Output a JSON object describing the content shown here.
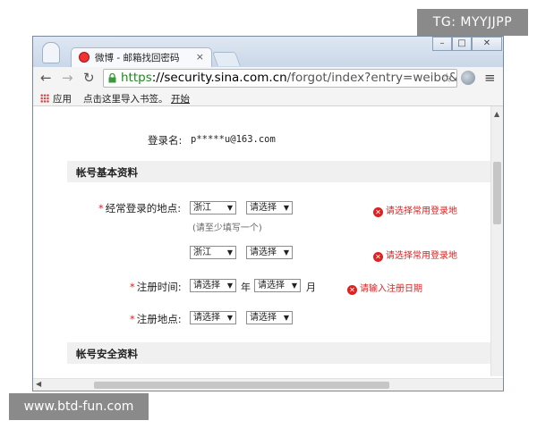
{
  "watermarks": {
    "top_right": "TG: MYYJJPP",
    "bottom_left": "www.btd-fun.com"
  },
  "browser": {
    "tab_title": "微博 - 邮箱找回密码",
    "tab_close": "×",
    "window_buttons": {
      "minimize": "–",
      "maximize": "□",
      "close": "✕"
    },
    "url": {
      "scheme": "https",
      "host": "://security.sina.com.cn",
      "path": "/forgot/index?entry=weibo&type"
    },
    "bookmarks": {
      "apps": "应用",
      "import_hint": "点击这里导入书签。",
      "start": "开始"
    }
  },
  "form": {
    "login_label": "登录名:",
    "login_value": "p*****u@163.com",
    "section_basic": "帐号基本资料",
    "section_security": "帐号安全资料",
    "required_mark": "*",
    "frequent_location_label": "经常登录的地点:",
    "frequent_location_hint": "(请至少填写一个)",
    "row1": {
      "province": "浙江",
      "city": "请选择"
    },
    "row2": {
      "province": "浙江",
      "city": "请选择"
    },
    "reg_time_label": "注册时间:",
    "reg_time": {
      "year": "请选择",
      "year_unit": "年",
      "month": "请选择",
      "month_unit": "月"
    },
    "reg_place_label": "注册地点:",
    "reg_place": {
      "province": "请选择",
      "city": "请选择"
    },
    "errors": {
      "location1": "请选择常用登录地",
      "location2": "请选择常用登录地",
      "reg_date": "请输入注册日期"
    },
    "error_icon": "✕"
  },
  "colors": {
    "error": "#dd2222",
    "https_green": "#1a8a1a",
    "section_bg": "#f0f0f0"
  }
}
